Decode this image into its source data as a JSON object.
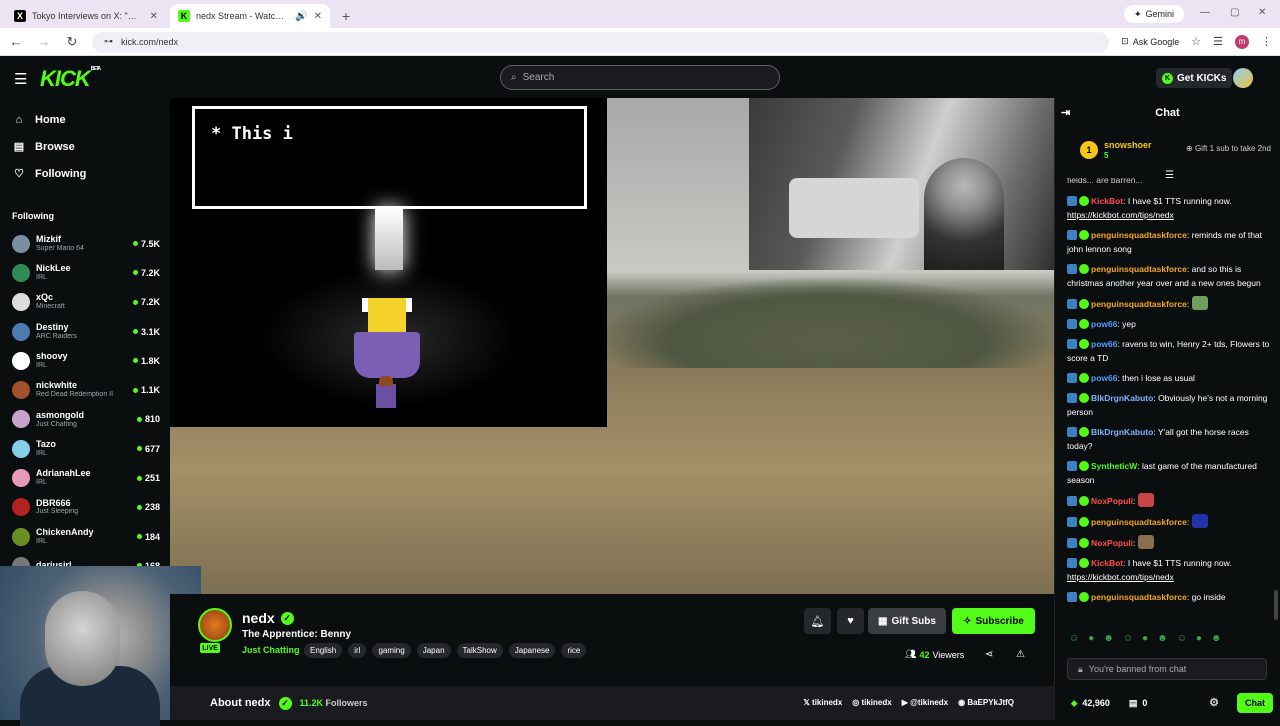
{
  "browser": {
    "tabs": [
      {
        "title": "Tokyo Interviews on X: \"@callis",
        "favicon": "X",
        "active": false
      },
      {
        "title": "nedx Stream - Watch Live o",
        "favicon": "K",
        "active": true
      }
    ],
    "new_tab_icon": "+",
    "gemini_label": "Gemini",
    "url": "kick.com/nedx",
    "ask_google_label": "Ask Google",
    "profile_letter": "m"
  },
  "header": {
    "logo": "KICK",
    "logo_badge": "BETA",
    "search_placeholder": "Search",
    "get_kicks_label": "Get KICKs"
  },
  "sidebar": {
    "nav": [
      {
        "label": "Home",
        "icon": "home-icon"
      },
      {
        "label": "Browse",
        "icon": "browse-icon"
      },
      {
        "label": "Following",
        "icon": "heart-icon"
      }
    ],
    "following_heading": "Following",
    "following": [
      {
        "name": "Mizkif",
        "category": "Super Mario 64",
        "viewers": "7.5K",
        "color": "#7b8fa3"
      },
      {
        "name": "NickLee",
        "category": "IRL",
        "viewers": "7.2K",
        "color": "#2e8b57"
      },
      {
        "name": "xQc",
        "category": "Minecraft",
        "viewers": "7.2K",
        "color": "#dddddd"
      },
      {
        "name": "Destiny",
        "category": "ARC Raiders",
        "viewers": "3.1K",
        "color": "#4d7bb0"
      },
      {
        "name": "shoovy",
        "category": "IRL",
        "viewers": "1.8K",
        "color": "#ffffff"
      },
      {
        "name": "nickwhite",
        "category": "Red Dead Redemption II",
        "viewers": "1.1K",
        "color": "#a0522d"
      },
      {
        "name": "asmongold",
        "category": "Just Chatting",
        "viewers": "810",
        "color": "#c8a2c8"
      },
      {
        "name": "Tazo",
        "category": "IRL",
        "viewers": "677",
        "color": "#87ceeb"
      },
      {
        "name": "AdrianahLee",
        "category": "IRL",
        "viewers": "251",
        "color": "#e79ab8"
      },
      {
        "name": "DBR666",
        "category": "Just Sleeping",
        "viewers": "238",
        "color": "#b22222"
      },
      {
        "name": "ChickenAndy",
        "category": "IRL",
        "viewers": "184",
        "color": "#6b8e23"
      },
      {
        "name": "dariusirl",
        "category": "",
        "viewers": "168",
        "color": "#777777"
      }
    ]
  },
  "video": {
    "dialog_text": "* This i"
  },
  "stream": {
    "name": "nedx",
    "title": "The Apprentice: Benny",
    "category": "Just Chatting",
    "live_label": "LIVE",
    "tags": [
      "English",
      "irl",
      "gaming",
      "Japan",
      "TalkShow",
      "Japanese",
      "rice"
    ],
    "gift_subs_label": "Gift Subs",
    "subscribe_label": "Subscribe",
    "viewers": "42",
    "viewers_label": "Viewers",
    "about_label": "About nedx",
    "followers_count": "11.2K",
    "followers_label": "Followers",
    "socials": [
      "tikinedx",
      "tikinedx",
      "@tikinedx",
      "BaEPYkJtfQ"
    ]
  },
  "chat": {
    "title": "Chat",
    "pinned": {
      "user": "snowshoer",
      "rank": "1",
      "count": "5",
      "gift_text": "Gift 1 sub to take 2nd"
    },
    "cut_message": "fields... are barren...",
    "messages": [
      {
        "user": "KickBot",
        "color": "#ff4b4b",
        "text": ": I have $1 TTS running now.",
        "link": "https://kickbot.com/tips/nedx"
      },
      {
        "user": "penguinsquadtaskforce",
        "color": "#f5a623",
        "text": ": reminds me of that john lennon song",
        "link": ""
      },
      {
        "user": "penguinsquadtaskforce",
        "color": "#f5a623",
        "text": ": and so this is christmas another year over and a new ones begun",
        "link": ""
      },
      {
        "user": "penguinsquadtaskforce",
        "color": "#f5a623",
        "text": ":",
        "link": ""
      },
      {
        "user": "pow66",
        "color": "#4f9bff",
        "text": ": yep",
        "link": ""
      },
      {
        "user": "pow66",
        "color": "#4f9bff",
        "text": ": ravens to win, Henry 2+ tds, Flowers to score a TD",
        "link": ""
      },
      {
        "user": "pow66",
        "color": "#4f9bff",
        "text": ": then i lose as usual",
        "link": ""
      },
      {
        "user": "BlkDrgnKabuto",
        "color": "#7fb3ff",
        "text": ": Obviously he's not a morning person",
        "link": ""
      },
      {
        "user": "BlkDrgnKabuto",
        "color": "#7fb3ff",
        "text": ": Y'all got the horse races today?",
        "link": ""
      },
      {
        "user": "SyntheticW",
        "color": "#53fc18",
        "text": ": last game of the manufactured season",
        "link": ""
      },
      {
        "user": "NoxPopuli",
        "color": "#ff4b4b",
        "text": ":",
        "link": ""
      },
      {
        "user": "penguinsquadtaskforce",
        "color": "#f5a623",
        "text": ":",
        "link": ""
      },
      {
        "user": "NoxPopuli",
        "color": "#ff4b4b",
        "text": ":",
        "link": ""
      },
      {
        "user": "KickBot",
        "color": "#ff4b4b",
        "text": ": I have $1 TTS running now.",
        "link": "https://kickbot.com/tips/nedx"
      },
      {
        "user": "penguinsquadtaskforce",
        "color": "#f5a623",
        "text": ": go inside",
        "link": ""
      }
    ],
    "banned_text": "You're banned from chat",
    "kicks_balance": "42,960",
    "subs_count": "0",
    "send_label": "Chat"
  }
}
